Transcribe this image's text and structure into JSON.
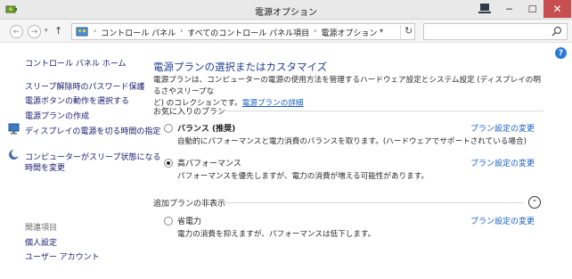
{
  "window": {
    "title": "電源オプション",
    "minimize_glyph": "─",
    "maximize_glyph": "☐",
    "close_glyph": "✕"
  },
  "address_bar": {
    "back_glyph": "←",
    "forward_glyph": "→",
    "up_glyph": "↑",
    "dropdown_glyph": "▾",
    "refresh_glyph": "↻",
    "breadcrumbs": [
      "コントロール パネル",
      "すべてのコントロール パネル項目",
      "電源オプション"
    ],
    "crumb_separator": "›",
    "search_placeholder": ""
  },
  "help": {
    "glyph": "?"
  },
  "sidebar": {
    "home": "コントロール パネル ホーム",
    "items": [
      "スリープ解除時のパスワード保護",
      "電源ボタンの動作を選択する",
      "電源プランの作成",
      "ディスプレイの電源を切る時間の指定",
      "コンピューターがスリープ状態になる",
      "時間を変更"
    ],
    "related_label": "関連項目",
    "related": [
      "個人設定",
      "ユーザー アカウント"
    ]
  },
  "main": {
    "title": "電源プランの選択またはカスタマイズ",
    "description_line1": "電源プランは、コンピューターの電源の使用方法を管理するハードウェア設定とシステム設定 (ディスプレイの明るさやスリープな",
    "description_line2": "ど) のコレクションです。",
    "description_link": "電源プランの詳細",
    "favorites_label": "お気に入りのプラン",
    "hidden_label": "追加プランの非表示",
    "collapse_glyph": "⌃",
    "plans": [
      {
        "name": "バランス (推奨)",
        "description": "自動的にパフォーマンスと電力消費のバランスを取ります。(ハードウェアでサポートされている場合)",
        "link": "プラン設定の変更",
        "selected": false
      },
      {
        "name": "高パフォーマンス",
        "description": "パフォーマンスを優先しますが、電力の消費が増える可能性があります。",
        "link": "プラン設定の変更",
        "selected": true
      },
      {
        "name": "省電力",
        "description": "電力の消費を抑えますが、パフォーマンスは低下します。",
        "link": "プラン設定の変更",
        "selected": false
      }
    ]
  },
  "colors": {
    "title_blue": "#1f3f8f",
    "link_blue": "#1a5fbf",
    "close_red": "#c74f4f"
  }
}
